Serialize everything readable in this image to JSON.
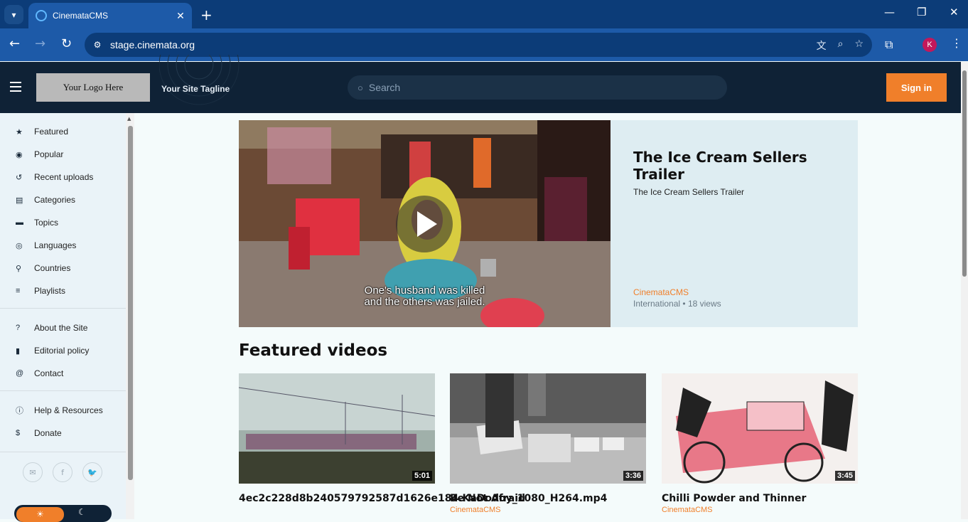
{
  "browser": {
    "tab_title": "CinemataCMS",
    "url": "stage.cinemata.org",
    "profile_initial": "K"
  },
  "header": {
    "logo_text": "Your Logo Here",
    "tagline": "Your Site Tagline",
    "search_placeholder": "Search",
    "signin_label": "Sign in"
  },
  "sidebar": {
    "main": [
      {
        "label": "Featured",
        "icon": "star-icon"
      },
      {
        "label": "Popular",
        "icon": "trending-icon"
      },
      {
        "label": "Recent uploads",
        "icon": "history-icon"
      },
      {
        "label": "Categories",
        "icon": "folder-icon"
      },
      {
        "label": "Topics",
        "icon": "chat-icon"
      },
      {
        "label": "Languages",
        "icon": "globe-icon"
      },
      {
        "label": "Countries",
        "icon": "pin-icon"
      },
      {
        "label": "Playlists",
        "icon": "playlist-icon"
      }
    ],
    "info": [
      {
        "label": "About the Site",
        "icon": "help-icon"
      },
      {
        "label": "Editorial policy",
        "icon": "document-icon"
      },
      {
        "label": "Contact",
        "icon": "at-icon"
      }
    ],
    "support": [
      {
        "label": "Help & Resources",
        "icon": "info-icon"
      },
      {
        "label": "Donate",
        "icon": "dollar-icon"
      }
    ]
  },
  "hero": {
    "title": "The Ice Cream Sellers Trailer",
    "description": "The Ice Cream Sellers Trailer",
    "author": "CinemataCMS",
    "category": "International",
    "views": "18 views",
    "subtitle_line1": "One's husband was killed",
    "subtitle_line2": "and the others was jailed."
  },
  "featured": {
    "section_title": "Featured videos",
    "videos": [
      {
        "title": "4ec2c228d8b240579792587d1626e184.KaDodoy_1080_H264.mp4",
        "duration": "5:01",
        "author": ""
      },
      {
        "title": "Be Not Afraid",
        "duration": "3:36",
        "author": "CinemataCMS"
      },
      {
        "title": "Chilli Powder and Thinner",
        "duration": "3:45",
        "author": "CinemataCMS"
      }
    ]
  },
  "colors": {
    "accent": "#f07f2a",
    "header_bg": "#0f2236",
    "sidebar_bg": "#eaf3f8"
  }
}
